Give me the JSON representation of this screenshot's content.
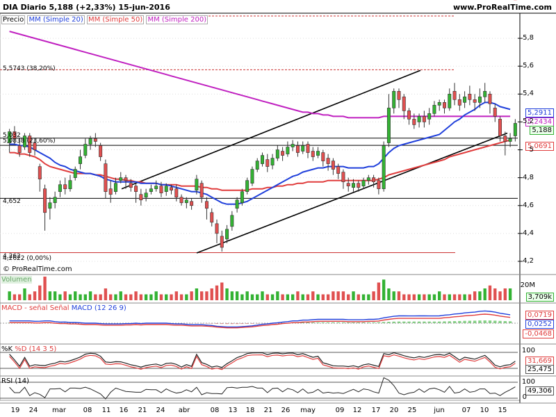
{
  "header": {
    "title": "DIA   Diario   5,188 (+2,33%)   15-jun-2016",
    "site": "www.ProRealTime.com",
    "copyright": "© ProRealTime.com"
  },
  "legend": {
    "price": "Precio",
    "mm20": "MM (Simple 20)",
    "mm50": "MM (Simple 50)",
    "mm200": "MM (Simple 200)"
  },
  "colors": {
    "bull": "#33b233",
    "bear": "#e05050",
    "mm20": "#1f3fdb",
    "mm50": "#e03c3c",
    "mm200": "#c020c0",
    "channel": "#000000",
    "fib": "#cc3333"
  },
  "levels": {
    "fib382": "5,5743 (38,20%)",
    "fib236": "5,0838 (23,60%)",
    "fib0": "4,2622 (0,00%)",
    "support": "4,652",
    "resist_short": "5,032",
    "low_short": "4,262"
  },
  "price_tags": {
    "mm20": "5,2911",
    "mm200": "5,2434",
    "last": "5,188",
    "mm50": "5,0691"
  },
  "sub_panels": {
    "volume": {
      "label": "Volumen",
      "ymax": "20M",
      "value": "3,709k"
    },
    "macd": {
      "label": "MACD - señal",
      "label2": "Señal",
      "label3": "MACD (12 26 9)",
      "v1": "0,0719",
      "v2": "0,0252",
      "v3": "-0,0468"
    },
    "stoch": {
      "label1": "%K",
      "label2": "%D (14 3 5)",
      "v100": "100",
      "v1": "31,669",
      "v2": "25,475"
    },
    "rsi": {
      "label": "RSI (14)",
      "v100": "100",
      "value": "49,306",
      "v0": "0"
    }
  },
  "chart_data": {
    "type": "candlestick",
    "title": "DIA Diario 5,188 (+2,33%) 15-jun-2016",
    "y_ticks": [
      "5,8",
      "5,6",
      "5,4",
      "5,2",
      "5",
      "4,8",
      "4,6",
      "4,4",
      "4,2"
    ],
    "ylim": [
      4.18,
      5.98
    ],
    "x_labels": [
      "19",
      "24",
      "mar",
      "08",
      "11",
      "16",
      "21",
      "24",
      "abr",
      "08",
      "13",
      "18",
      "21",
      "26",
      "may",
      "09",
      "12",
      "17",
      "20",
      "25",
      "jun",
      "07",
      "10",
      "15"
    ],
    "candles": [
      [
        5.05,
        5.13,
        5.15,
        4.98
      ],
      [
        5.13,
        5.08,
        5.17,
        5.04
      ],
      [
        5.03,
        4.98,
        5.08,
        4.95
      ],
      [
        5.02,
        5.1,
        5.12,
        5.0
      ],
      [
        5.1,
        4.98,
        5.12,
        4.95
      ],
      [
        5.05,
        5.0,
        5.08,
        4.96
      ],
      [
        4.88,
        4.79,
        4.9,
        4.7
      ],
      [
        4.72,
        4.55,
        4.75,
        4.42
      ],
      [
        4.58,
        4.62,
        4.66,
        4.5
      ],
      [
        4.62,
        4.66,
        4.7,
        4.58
      ],
      [
        4.7,
        4.75,
        4.78,
        4.66
      ],
      [
        4.75,
        4.72,
        4.8,
        4.68
      ],
      [
        4.72,
        4.78,
        4.82,
        4.7
      ],
      [
        4.8,
        4.86,
        4.88,
        4.78
      ],
      [
        4.9,
        4.95,
        5.0,
        4.86
      ],
      [
        4.96,
        5.04,
        5.08,
        4.94
      ],
      [
        5.04,
        5.08,
        5.1,
        5.0
      ],
      [
        5.08,
        5.06,
        5.12,
        5.02
      ],
      [
        5.03,
        4.95,
        5.05,
        4.92
      ],
      [
        4.9,
        4.7,
        4.93,
        4.65
      ],
      [
        4.72,
        4.68,
        4.78,
        4.62
      ],
      [
        4.7,
        4.76,
        4.8,
        4.68
      ],
      [
        4.78,
        4.8,
        4.84,
        4.76
      ],
      [
        4.8,
        4.78,
        4.82,
        4.72
      ],
      [
        4.76,
        4.73,
        4.79,
        4.7
      ],
      [
        4.74,
        4.7,
        4.76,
        4.62
      ],
      [
        4.68,
        4.64,
        4.72,
        4.6
      ],
      [
        4.66,
        4.69,
        4.72,
        4.63
      ],
      [
        4.7,
        4.72,
        4.75,
        4.68
      ],
      [
        4.72,
        4.74,
        4.78,
        4.7
      ],
      [
        4.74,
        4.69,
        4.77,
        4.66
      ],
      [
        4.7,
        4.74,
        4.76,
        4.67
      ],
      [
        4.73,
        4.71,
        4.75,
        4.68
      ],
      [
        4.72,
        4.66,
        4.75,
        4.63
      ],
      [
        4.66,
        4.62,
        4.68,
        4.6
      ],
      [
        4.62,
        4.64,
        4.66,
        4.58
      ],
      [
        4.63,
        4.6,
        4.65,
        4.57
      ],
      [
        4.71,
        4.79,
        4.82,
        4.68
      ],
      [
        4.76,
        4.66,
        4.78,
        4.62
      ],
      [
        4.63,
        4.58,
        4.66,
        4.5
      ],
      [
        4.55,
        4.48,
        4.58,
        4.45
      ],
      [
        4.47,
        4.4,
        4.5,
        4.33
      ],
      [
        4.38,
        4.3,
        4.42,
        4.27
      ],
      [
        4.36,
        4.43,
        4.46,
        4.33
      ],
      [
        4.45,
        4.53,
        4.56,
        4.42
      ],
      [
        4.58,
        4.64,
        4.66,
        4.55
      ],
      [
        4.62,
        4.7,
        4.72,
        4.6
      ],
      [
        4.7,
        4.78,
        4.8,
        4.68
      ],
      [
        4.76,
        4.86,
        4.88,
        4.74
      ],
      [
        4.86,
        4.92,
        4.94,
        4.84
      ],
      [
        4.9,
        4.96,
        4.98,
        4.88
      ],
      [
        4.93,
        4.88,
        4.97,
        4.84
      ],
      [
        4.89,
        4.94,
        4.97,
        4.86
      ],
      [
        4.94,
        5.0,
        5.03,
        4.92
      ],
      [
        4.99,
        4.96,
        5.02,
        4.92
      ],
      [
        4.97,
        5.02,
        5.06,
        4.95
      ],
      [
        5.02,
        5.04,
        5.07,
        4.99
      ],
      [
        5.03,
        4.98,
        5.06,
        4.95
      ],
      [
        4.99,
        5.03,
        5.06,
        4.97
      ],
      [
        5.04,
        4.98,
        5.06,
        4.94
      ],
      [
        4.99,
        4.95,
        5.02,
        4.92
      ],
      [
        4.96,
        4.99,
        5.02,
        4.94
      ],
      [
        4.98,
        4.92,
        5.0,
        4.88
      ],
      [
        4.94,
        4.9,
        4.97,
        4.85
      ],
      [
        4.92,
        4.86,
        4.94,
        4.82
      ],
      [
        4.88,
        4.83,
        4.9,
        4.79
      ],
      [
        4.84,
        4.77,
        4.86,
        4.72
      ],
      [
        4.76,
        4.74,
        4.8,
        4.7
      ],
      [
        4.73,
        4.76,
        4.79,
        4.7
      ],
      [
        4.76,
        4.73,
        4.78,
        4.7
      ],
      [
        4.74,
        4.78,
        4.8,
        4.72
      ],
      [
        4.78,
        4.8,
        4.82,
        4.75
      ],
      [
        4.8,
        4.77,
        4.82,
        4.73
      ],
      [
        4.78,
        4.72,
        4.8,
        4.68
      ],
      [
        4.72,
        5.03,
        5.06,
        4.7
      ],
      [
        5.05,
        5.3,
        5.4,
        5.02
      ],
      [
        5.3,
        5.42,
        5.44,
        5.26
      ],
      [
        5.42,
        5.36,
        5.44,
        5.3
      ],
      [
        5.38,
        5.28,
        5.4,
        5.22
      ],
      [
        5.28,
        5.22,
        5.3,
        5.18
      ],
      [
        5.22,
        5.18,
        5.26,
        5.15
      ],
      [
        5.2,
        5.24,
        5.26,
        5.16
      ],
      [
        5.24,
        5.2,
        5.28,
        5.16
      ],
      [
        5.22,
        5.26,
        5.3,
        5.18
      ],
      [
        5.26,
        5.32,
        5.35,
        5.24
      ],
      [
        5.32,
        5.34,
        5.36,
        5.28
      ],
      [
        5.34,
        5.3,
        5.36,
        5.26
      ],
      [
        5.3,
        5.4,
        5.44,
        5.28
      ],
      [
        5.42,
        5.36,
        5.48,
        5.32
      ],
      [
        5.36,
        5.32,
        5.4,
        5.28
      ],
      [
        5.34,
        5.38,
        5.42,
        5.3
      ],
      [
        5.4,
        5.36,
        5.46,
        5.32
      ],
      [
        5.36,
        5.34,
        5.4,
        5.28
      ],
      [
        5.34,
        5.38,
        5.44,
        5.3
      ],
      [
        5.38,
        5.42,
        5.48,
        5.34
      ],
      [
        5.4,
        5.33,
        5.42,
        5.26
      ],
      [
        5.3,
        5.24,
        5.33,
        5.2
      ],
      [
        5.22,
        5.1,
        5.24,
        5.06
      ],
      [
        5.1,
        5.06,
        5.13,
        4.96
      ],
      [
        5.06,
        5.08,
        5.12,
        5.02
      ],
      [
        5.1,
        5.19,
        5.22,
        5.06
      ]
    ],
    "mm20": [
      5.04,
      5.04,
      5.03,
      5.03,
      5.02,
      5.0,
      4.98,
      4.96,
      4.94,
      4.91,
      4.89,
      4.88,
      4.86,
      4.85,
      4.84,
      4.83,
      4.83,
      4.82,
      4.81,
      4.79,
      4.78,
      4.77,
      4.77,
      4.77,
      4.77,
      4.77,
      4.76,
      4.76,
      4.76,
      4.76,
      4.75,
      4.75,
      4.74,
      4.73,
      4.72,
      4.71,
      4.7,
      4.7,
      4.69,
      4.68,
      4.66,
      4.64,
      4.62,
      4.61,
      4.61,
      4.61,
      4.62,
      4.63,
      4.65,
      4.67,
      4.69,
      4.71,
      4.73,
      4.75,
      4.77,
      4.79,
      4.81,
      4.82,
      4.84,
      4.85,
      4.86,
      4.87,
      4.87,
      4.88,
      4.88,
      4.88,
      4.88,
      4.87,
      4.87,
      4.87,
      4.87,
      4.88,
      4.88,
      4.9,
      4.94,
      4.98,
      5.01,
      5.03,
      5.04,
      5.05,
      5.06,
      5.07,
      5.08,
      5.09,
      5.1,
      5.11,
      5.14,
      5.17,
      5.2,
      5.22,
      5.25,
      5.27,
      5.29,
      5.32,
      5.34,
      5.34,
      5.33,
      5.31,
      5.3,
      5.29
    ],
    "mm50": [
      4.98,
      4.98,
      4.97,
      4.97,
      4.96,
      4.95,
      4.93,
      4.9,
      4.88,
      4.87,
      4.86,
      4.85,
      4.84,
      4.83,
      4.83,
      4.83,
      4.83,
      4.82,
      4.82,
      4.81,
      4.8,
      4.79,
      4.79,
      4.78,
      4.78,
      4.77,
      4.77,
      4.76,
      4.76,
      4.76,
      4.75,
      4.75,
      4.75,
      4.75,
      4.74,
      4.74,
      4.74,
      4.74,
      4.73,
      4.73,
      4.72,
      4.72,
      4.71,
      4.71,
      4.71,
      4.71,
      4.71,
      4.71,
      4.72,
      4.72,
      4.72,
      4.73,
      4.73,
      4.74,
      4.74,
      4.75,
      4.75,
      4.76,
      4.76,
      4.77,
      4.77,
      4.77,
      4.77,
      4.78,
      4.78,
      4.78,
      4.78,
      4.78,
      4.78,
      4.78,
      4.78,
      4.78,
      4.78,
      4.79,
      4.8,
      4.82,
      4.83,
      4.84,
      4.85,
      4.86,
      4.87,
      4.88,
      4.89,
      4.9,
      4.91,
      4.92,
      4.93,
      4.95,
      4.96,
      4.97,
      4.98,
      4.99,
      5.0,
      5.01,
      5.02,
      5.03,
      5.04,
      5.05,
      5.06,
      5.07
    ],
    "mm200": [
      5.85,
      5.84,
      5.83,
      5.82,
      5.81,
      5.8,
      5.79,
      5.78,
      5.77,
      5.76,
      5.75,
      5.74,
      5.73,
      5.72,
      5.71,
      5.7,
      5.69,
      5.68,
      5.67,
      5.66,
      5.65,
      5.64,
      5.63,
      5.62,
      5.61,
      5.6,
      5.59,
      5.58,
      5.57,
      5.56,
      5.55,
      5.54,
      5.53,
      5.52,
      5.51,
      5.5,
      5.49,
      5.48,
      5.47,
      5.46,
      5.45,
      5.44,
      5.43,
      5.42,
      5.41,
      5.4,
      5.39,
      5.38,
      5.37,
      5.36,
      5.35,
      5.34,
      5.33,
      5.32,
      5.31,
      5.3,
      5.29,
      5.28,
      5.27,
      5.27,
      5.26,
      5.26,
      5.25,
      5.25,
      5.24,
      5.24,
      5.24,
      5.23,
      5.23,
      5.23,
      5.23,
      5.23,
      5.23,
      5.23,
      5.24,
      5.24,
      5.24,
      5.24,
      5.24,
      5.24,
      5.24,
      5.24,
      5.24,
      5.24,
      5.24,
      5.24,
      5.24,
      5.24,
      5.24,
      5.24,
      5.24,
      5.24,
      5.24,
      5.24,
      5.24,
      5.24,
      5.24,
      5.24,
      5.24,
      5.24
    ],
    "volume": [
      3,
      2,
      2,
      4,
      2,
      3,
      5,
      8,
      3,
      3,
      2,
      3,
      2,
      3,
      2,
      2,
      3,
      2,
      2,
      4,
      2,
      2,
      3,
      2,
      2,
      3,
      2,
      2,
      2,
      3,
      2,
      2,
      2,
      3,
      2,
      2,
      3,
      4,
      3,
      3,
      4,
      5,
      6,
      4,
      3,
      3,
      2,
      3,
      2,
      2,
      3,
      2,
      2,
      3,
      2,
      2,
      2,
      3,
      2,
      2,
      3,
      2,
      2,
      2,
      3,
      3,
      3,
      2,
      3,
      2,
      2,
      2,
      3,
      6,
      7,
      4,
      3,
      3,
      2,
      2,
      2,
      2,
      2,
      2,
      2,
      3,
      2,
      2,
      2,
      2,
      2,
      2,
      3,
      3,
      4,
      5,
      4,
      3,
      4,
      4
    ]
  }
}
